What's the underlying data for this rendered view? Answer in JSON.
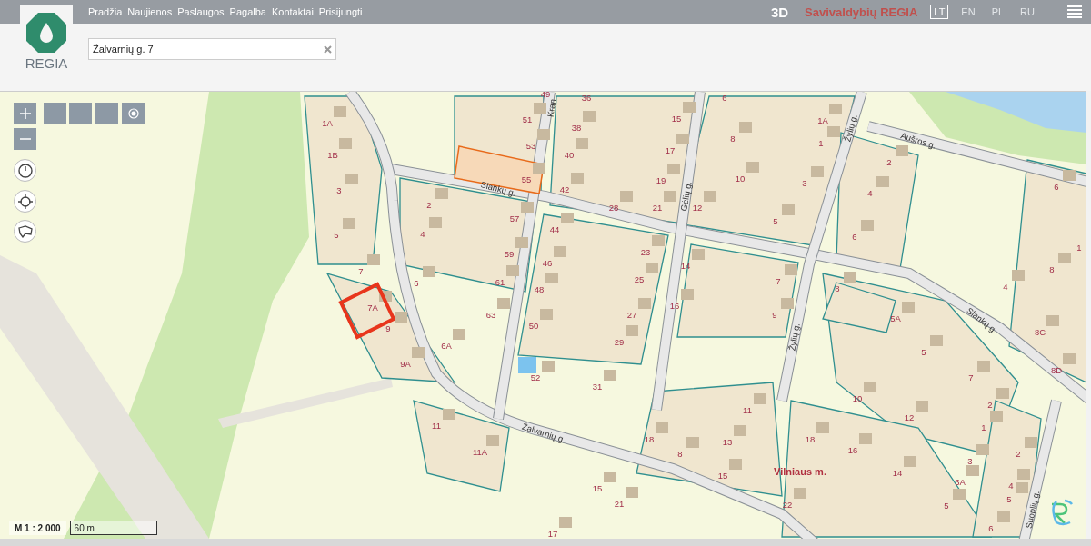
{
  "top_bar": {
    "logo_text": "REGIA",
    "nav": [
      "Pradžia",
      "Naujienos",
      "Paslaugos",
      "Pagalba",
      "Kontaktai",
      "Prisijungti"
    ],
    "mode_button": "3D",
    "brand": "Savivaldybių REGIA",
    "languages": [
      {
        "label": "LT",
        "selected": true
      },
      {
        "label": "EN",
        "selected": false
      },
      {
        "label": "PL",
        "selected": false
      },
      {
        "label": "RU",
        "selected": false
      }
    ]
  },
  "search": {
    "value": "Žalvarnių g. 7"
  },
  "map": {
    "streets": [
      "Kran",
      "Aušros g.",
      "Žylių g.",
      "Slankų g.",
      "Gėlių g.",
      "Slankų g.",
      "Žylių g.",
      "Žalvarnių g.",
      "Suoplių g."
    ],
    "parcels": [
      {
        "label": "49",
        "selected": false
      },
      {
        "label": "36",
        "selected": false
      },
      {
        "label": "6",
        "selected": false
      },
      {
        "label": "1A",
        "selected": false
      },
      {
        "label": "51",
        "selected": false
      },
      {
        "label": "38",
        "selected": false
      },
      {
        "label": "15",
        "selected": false
      },
      {
        "label": "1A",
        "selected": false
      },
      {
        "label": "1B",
        "selected": false
      },
      {
        "label": "53",
        "selected": false
      },
      {
        "label": "40",
        "selected": false
      },
      {
        "label": "17",
        "selected": false
      },
      {
        "label": "8",
        "selected": false
      },
      {
        "label": "1",
        "selected": false
      },
      {
        "label": "55",
        "selected": false
      },
      {
        "label": "19",
        "selected": false
      },
      {
        "label": "10",
        "selected": false
      },
      {
        "label": "2",
        "selected": false
      },
      {
        "label": "3",
        "selected": false
      },
      {
        "label": "42",
        "selected": false
      },
      {
        "label": "3",
        "selected": false
      },
      {
        "label": "4",
        "selected": false
      },
      {
        "label": "6",
        "selected": false
      },
      {
        "label": "2",
        "selected": false
      },
      {
        "label": "57",
        "selected": false
      },
      {
        "label": "28",
        "selected": false
      },
      {
        "label": "21",
        "selected": false
      },
      {
        "label": "12",
        "selected": false
      },
      {
        "label": "5",
        "selected": false
      },
      {
        "label": "5",
        "selected": false
      },
      {
        "label": "4",
        "selected": false
      },
      {
        "label": "44",
        "selected": false
      },
      {
        "label": "6",
        "selected": false
      },
      {
        "label": "1",
        "selected": false
      },
      {
        "label": "7",
        "selected": false
      },
      {
        "label": "59",
        "selected": false
      },
      {
        "label": "46",
        "selected": false
      },
      {
        "label": "23",
        "selected": false
      },
      {
        "label": "14",
        "selected": false
      },
      {
        "label": "8",
        "selected": false
      },
      {
        "label": "6",
        "selected": false
      },
      {
        "label": "61",
        "selected": false
      },
      {
        "label": "48",
        "selected": false
      },
      {
        "label": "25",
        "selected": false
      },
      {
        "label": "7",
        "selected": false
      },
      {
        "label": "8",
        "selected": false
      },
      {
        "label": "4",
        "selected": false
      },
      {
        "label": "7A",
        "selected": true
      },
      {
        "label": "63",
        "selected": false
      },
      {
        "label": "27",
        "selected": false
      },
      {
        "label": "16",
        "selected": false
      },
      {
        "label": "9",
        "selected": false
      },
      {
        "label": "9",
        "selected": false
      },
      {
        "label": "50",
        "selected": false
      },
      {
        "label": "5A",
        "selected": false
      },
      {
        "label": "8C",
        "selected": false
      },
      {
        "label": "6A",
        "selected": false
      },
      {
        "label": "29",
        "selected": false
      },
      {
        "label": "5",
        "selected": false
      },
      {
        "label": "9A",
        "selected": false
      },
      {
        "label": "52",
        "selected": false
      },
      {
        "label": "7",
        "selected": false
      },
      {
        "label": "8D",
        "selected": false
      },
      {
        "label": "31",
        "selected": false
      },
      {
        "label": "10",
        "selected": false
      },
      {
        "label": "2",
        "selected": false
      },
      {
        "label": "11",
        "selected": false
      },
      {
        "label": "11",
        "selected": false
      },
      {
        "label": "12",
        "selected": false
      },
      {
        "label": "1",
        "selected": false
      },
      {
        "label": "11A",
        "selected": false
      },
      {
        "label": "18",
        "selected": false
      },
      {
        "label": "8",
        "selected": false
      },
      {
        "label": "13",
        "selected": false
      },
      {
        "label": "18",
        "selected": false
      },
      {
        "label": "16",
        "selected": false
      },
      {
        "label": "2",
        "selected": false
      },
      {
        "label": "15",
        "selected": false
      },
      {
        "label": "14",
        "selected": false
      },
      {
        "label": "3",
        "selected": false
      },
      {
        "label": "15",
        "selected": false
      },
      {
        "label": "3A",
        "selected": false
      },
      {
        "label": "4",
        "selected": false
      },
      {
        "label": "21",
        "selected": false
      },
      {
        "label": "22",
        "selected": false
      },
      {
        "label": "5",
        "selected": false
      },
      {
        "label": "5",
        "selected": false
      },
      {
        "label": "17",
        "selected": false
      },
      {
        "label": "6",
        "selected": false
      }
    ],
    "place_label": "Vilniaus m."
  },
  "scale": {
    "ratio": "M 1 : 2 000",
    "bar": "60 m"
  }
}
